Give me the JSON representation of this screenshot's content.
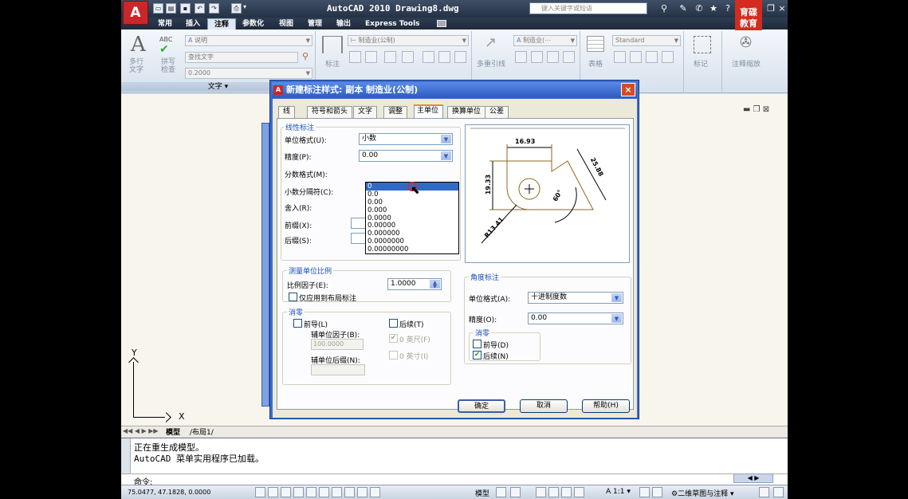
{
  "app": {
    "title": "AutoCAD 2010  Drawing8.dwg",
    "search_placeholder": "键入关键字或短语",
    "brand": [
      "育碟",
      "教育"
    ]
  },
  "ribbon_tabs": [
    "常用",
    "插入",
    "注释",
    "参数化",
    "视图",
    "管理",
    "输出",
    "Express Tools"
  ],
  "ribbon": {
    "text_panel": {
      "multiline_text": [
        "多行",
        "文字"
      ],
      "spell_check": [
        "拼写",
        "检查"
      ],
      "style_combo": "说明",
      "find_text_placeholder": "查找文字",
      "height_value": "0.2000",
      "label": "文字"
    },
    "dim_panel": {
      "style_combo": "制造业(公制)",
      "linear_label": "标注"
    },
    "leader_panel": {
      "multileader_label": "多重引线",
      "style_combo": "制造业(⋯"
    },
    "table_panel": {
      "table_label": "表格",
      "style_combo": "Standard"
    },
    "markup_label": "标记",
    "scale_label": "注释缩放"
  },
  "dialog": {
    "title": "新建标注样式: 副本 制造业(公制)",
    "tabs": [
      "线",
      "符号和箭头",
      "文字",
      "调整",
      "主单位",
      "换算单位",
      "公差"
    ],
    "linear": {
      "group_title": "线性标注",
      "unit_format_label": "单位格式(U):",
      "unit_format_value": "小数",
      "precision_label": "精度(P):",
      "precision_value": "0.00",
      "fraction_format_label": "分数格式(M):",
      "decimal_sep_label": "小数分隔符(C):",
      "roundoff_label": "舍入(R):",
      "prefix_label": "前缀(X):",
      "suffix_label": "后缀(S):",
      "precision_options": [
        "0",
        "0.0",
        "0.00",
        "0.000",
        "0.0000",
        "0.00000",
        "0.000000",
        "0.0000000",
        "0.00000000"
      ]
    },
    "measure": {
      "group_title": "测量单位比例",
      "scale_factor_label": "比例因子(E):",
      "scale_factor_value": "1.0000",
      "layout_only_label": "仅应用到布局标注"
    },
    "zero_sup": {
      "group_title": "消零",
      "leading_label": "前导(L)",
      "trailing_label": "后续(T)",
      "sub_unit_factor_label": "辅单位因子(B):",
      "sub_unit_factor_value": "100.0000",
      "sub_unit_suffix_label": "辅单位后缀(N):",
      "zero_feet_label": "0 英尺(F)",
      "zero_inches_label": "0 英寸(I)"
    },
    "angular": {
      "group_title": "角度标注",
      "unit_format_label": "单位格式(A):",
      "unit_format_value": "十进制度数",
      "precision_label": "精度(O):",
      "precision_value": "0.00",
      "zero_title": "消零",
      "leading_label": "前导(D)",
      "trailing_label": "后续(N)"
    },
    "preview_dims": {
      "top": "16.93",
      "left": "19.33",
      "right": "25.88",
      "angle": "60°",
      "radius": "R13.41"
    },
    "buttons": {
      "ok": "确定",
      "cancel": "取消",
      "help": "帮助(H)"
    }
  },
  "layout_tabs": [
    "模型",
    "布局1"
  ],
  "axis": {
    "x": "X",
    "y": "Y"
  },
  "command_line": {
    "line1": "正在重生成模型。",
    "line2": "AutoCAD 菜单实用程序已加载。",
    "prompt": "命令:"
  },
  "status": {
    "coordinates": "75.0477, 47.1828, 0.0000",
    "model_label": "模型",
    "scale": "1:1",
    "workspace": "二维草图与注释"
  }
}
